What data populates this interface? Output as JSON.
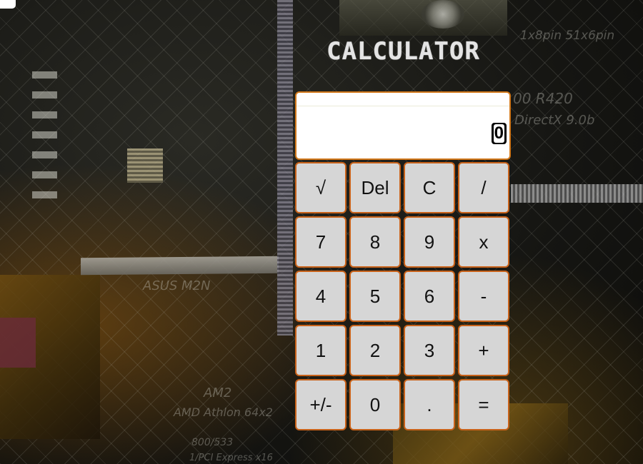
{
  "title": "CALCULATOR",
  "display": {
    "value": "0"
  },
  "keys": [
    {
      "label": "√",
      "name": "sqrt-button"
    },
    {
      "label": "Del",
      "name": "delete-button"
    },
    {
      "label": "C",
      "name": "clear-button"
    },
    {
      "label": "/",
      "name": "divide-button"
    },
    {
      "label": "7",
      "name": "digit-7-button"
    },
    {
      "label": "8",
      "name": "digit-8-button"
    },
    {
      "label": "9",
      "name": "digit-9-button"
    },
    {
      "label": "x",
      "name": "multiply-button"
    },
    {
      "label": "4",
      "name": "digit-4-button"
    },
    {
      "label": "5",
      "name": "digit-5-button"
    },
    {
      "label": "6",
      "name": "digit-6-button"
    },
    {
      "label": "-",
      "name": "subtract-button"
    },
    {
      "label": "1",
      "name": "digit-1-button"
    },
    {
      "label": "2",
      "name": "digit-2-button"
    },
    {
      "label": "3",
      "name": "digit-3-button"
    },
    {
      "label": "+",
      "name": "add-button"
    },
    {
      "label": "+/-",
      "name": "negate-button"
    },
    {
      "label": "0",
      "name": "digit-0-button"
    },
    {
      "label": ".",
      "name": "decimal-button"
    },
    {
      "label": "=",
      "name": "equals-button"
    }
  ],
  "background_text": {
    "pins": "1x8pin 51x6pin",
    "gpu": "00 R420",
    "directx": "DirectX 9.0b",
    "board": "ASUS M2N",
    "socket": "AM2",
    "cpu": "AMD Athlon 64x2",
    "fsb": "800/533",
    "pci": "1/PCI Express x16"
  },
  "colors": {
    "key_border": "#c8621a",
    "key_face": "#d6d6d6",
    "display_bg": "#ffffff"
  }
}
